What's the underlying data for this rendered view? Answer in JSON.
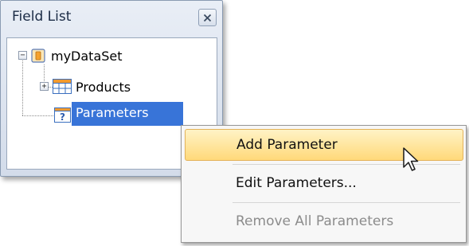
{
  "field_list": {
    "title": "Field List",
    "close_icon": "close-icon",
    "tree": {
      "root": {
        "label": "myDataSet",
        "icon": "database-icon",
        "expander": "−"
      },
      "child": {
        "label": "Products",
        "icon": "table-icon",
        "expander": "+"
      },
      "selected": {
        "label": "Parameters",
        "icon": "parameter-icon"
      }
    }
  },
  "context_menu": {
    "items": [
      {
        "label": "Add Parameter",
        "state": "highlighted"
      },
      {
        "label": "Edit Parameters...",
        "state": "normal"
      },
      {
        "label": "Remove All Parameters",
        "state": "disabled"
      }
    ]
  },
  "colors": {
    "selection": "#3874d8",
    "menu_highlight": "#ffd97a",
    "disabled_text": "#8c8c8c"
  }
}
